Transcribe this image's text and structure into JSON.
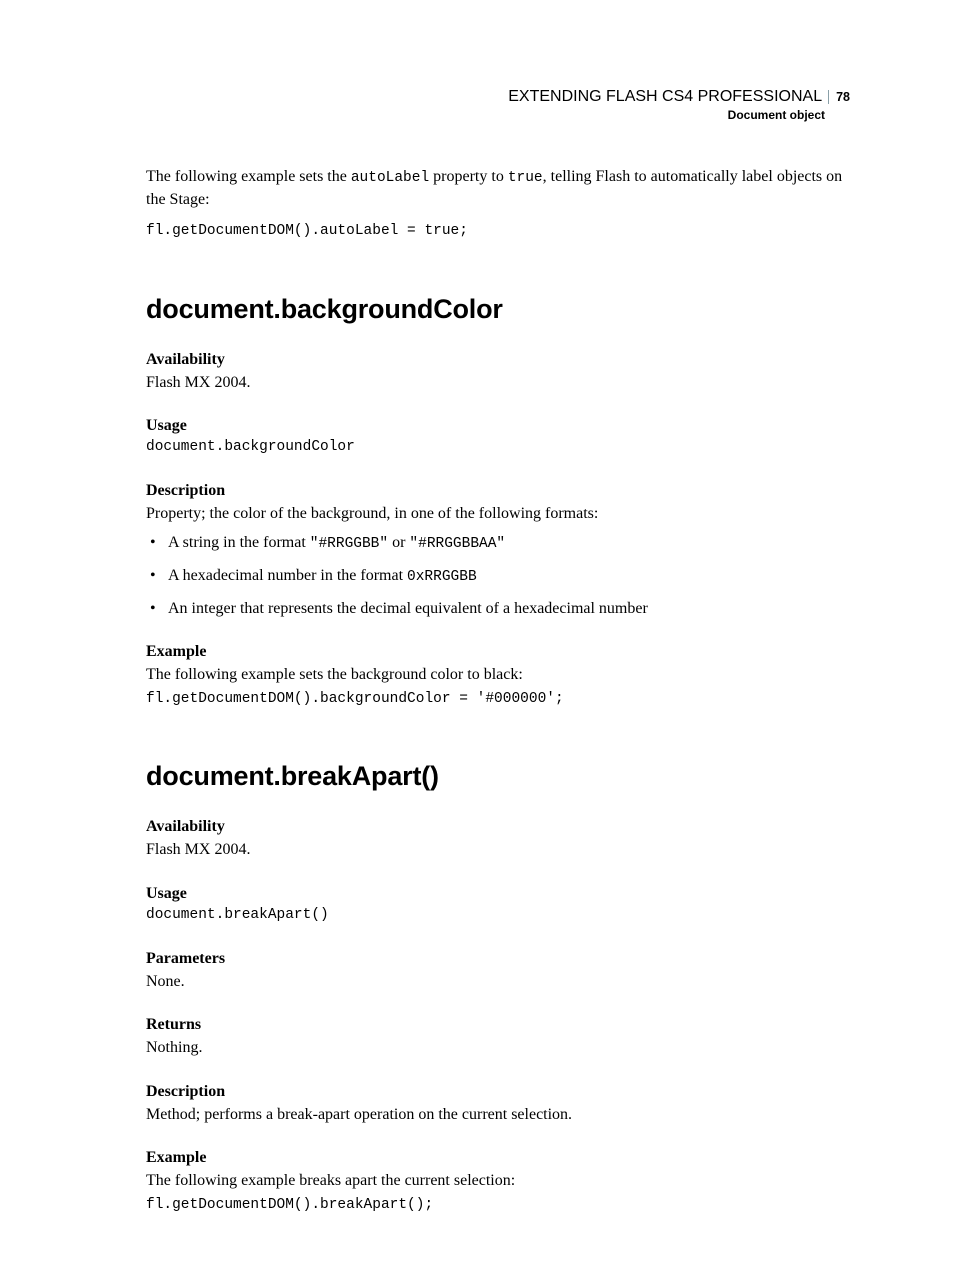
{
  "header": {
    "book_title": "EXTENDING FLASH CS4 PROFESSIONAL",
    "page_number": "78",
    "chapter": "Document object"
  },
  "intro": {
    "text_start": "The following example sets the ",
    "code1": "autoLabel",
    "text_mid1": " property to ",
    "code2": "true",
    "text_end": ", telling Flash to automatically label objects on the Stage:",
    "code_block": "fl.getDocumentDOM().autoLabel = true;"
  },
  "section1": {
    "title": "document.backgroundColor",
    "availability": {
      "label": "Availability",
      "text": "Flash MX 2004."
    },
    "usage": {
      "label": "Usage",
      "code": "document.backgroundColor"
    },
    "description": {
      "label": "Description",
      "text": "Property; the color of the background, in one of the following formats:",
      "bullets": [
        {
          "pre": "A string in the format ",
          "code1": "\"#RRGGBB\"",
          "mid": " or ",
          "code2": "\"#RRGGBBAA\""
        },
        {
          "pre": "A hexadecimal number in the format ",
          "code1": "0xRRGGBB"
        },
        {
          "pre": "An integer that represents the decimal equivalent of a hexadecimal number"
        }
      ]
    },
    "example": {
      "label": "Example",
      "text": "The following example sets the background color to black:",
      "code": "fl.getDocumentDOM().backgroundColor = '#000000';"
    }
  },
  "section2": {
    "title": "document.breakApart()",
    "availability": {
      "label": "Availability",
      "text": "Flash MX 2004."
    },
    "usage": {
      "label": "Usage",
      "code": "document.breakApart()"
    },
    "parameters": {
      "label": "Parameters",
      "text": "None."
    },
    "returns": {
      "label": "Returns",
      "text": "Nothing."
    },
    "description": {
      "label": "Description",
      "text": "Method; performs a break-apart operation on the current selection."
    },
    "example": {
      "label": "Example",
      "text": "The following example breaks apart the current selection:",
      "code": "fl.getDocumentDOM().breakApart();"
    }
  }
}
